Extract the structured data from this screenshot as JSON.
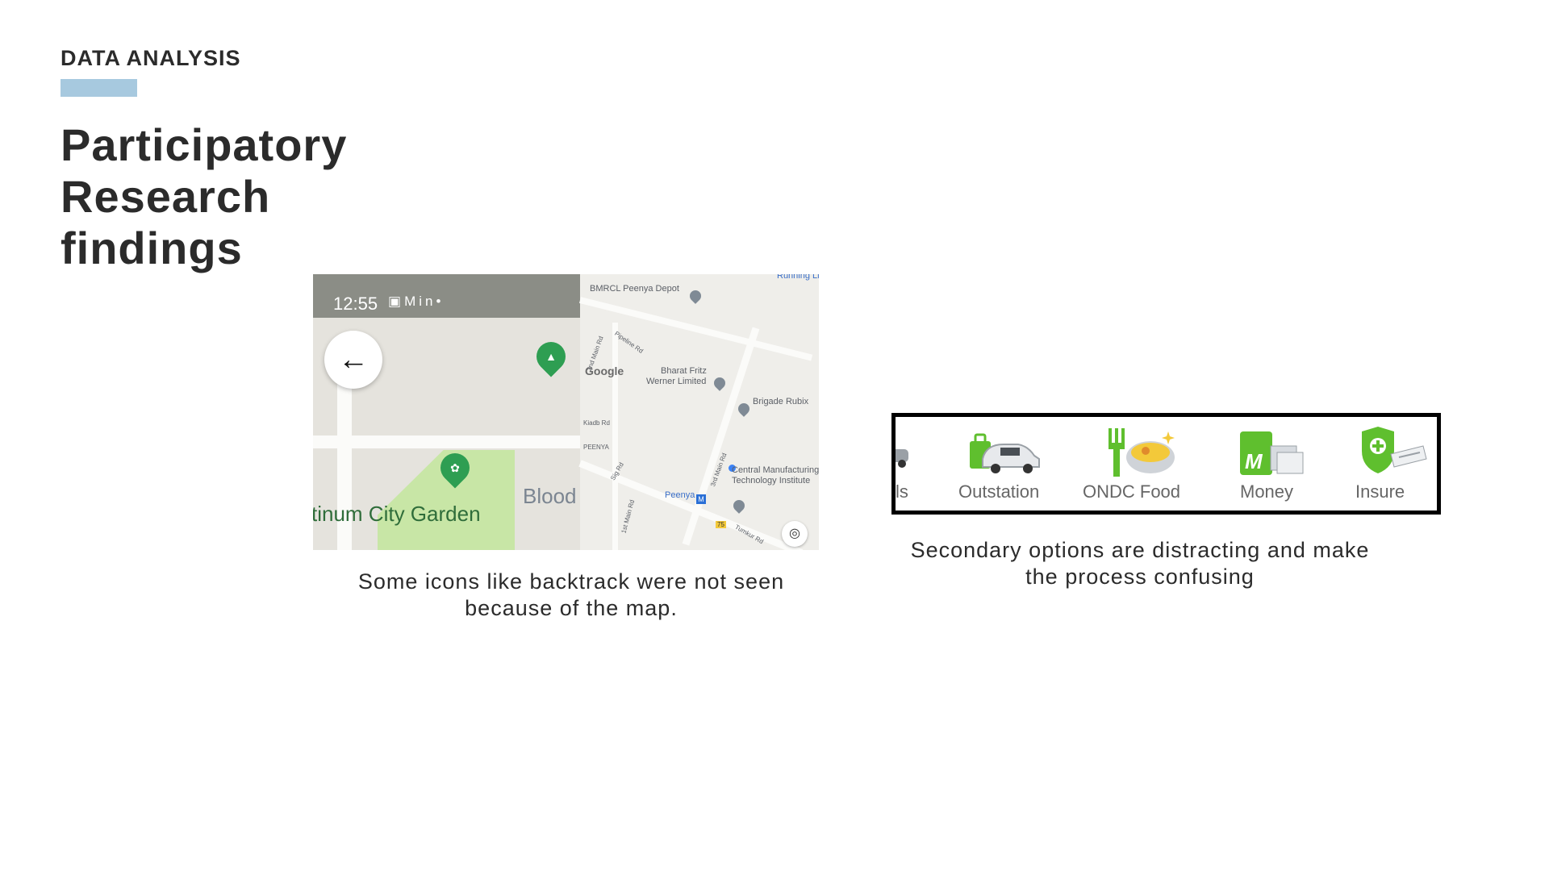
{
  "header": {
    "eyebrow": "DATA ANALYSIS",
    "title": "Participatory\nResearch\nfindings"
  },
  "colors": {
    "accent_bar": "#a7c9df",
    "heading_text": "#2b2b2b",
    "icon_green": "#5fbf2e"
  },
  "map_screenshot": {
    "status_time": "12:55",
    "status_icons": [
      "image-icon",
      "gmail-icon",
      "linkedin-icon",
      "dot-icon"
    ],
    "back_icon": "arrow-left-icon",
    "park_label": "tinum City Garden",
    "area_label": "Blood",
    "google_logo": "Google",
    "pois": {
      "depot": "BMRCL Peenya Depot",
      "running": "Running Lin",
      "bharat1": "Bharat Fritz",
      "bharat2": "Werner Limited",
      "brigade": "Brigade Rubix",
      "central1": "Central Manufacturing",
      "central2": "Technology Institute",
      "peenya_station": "Peenya",
      "peenya_area": "PEENYA",
      "kiadb": "Kiadb Rd",
      "pipeline": "Pipeline Rd",
      "main2": "2nd Main Rd",
      "main3": "3rd Main Rd",
      "main1": "1st Main Rd",
      "sig": "Sig Rd",
      "tumkur": "Tumkur Rd",
      "route": "75",
      "metro": "M"
    }
  },
  "captions": {
    "left": "Some icons like backtrack were not seen because of the map.",
    "right": "Secondary options are distracting and make the process confusing"
  },
  "icon_strip": {
    "items": [
      {
        "label": "ls",
        "icon": "car-icon"
      },
      {
        "label": "Outstation",
        "icon": "outstation-car-icon"
      },
      {
        "label": "ONDC Food",
        "icon": "food-bowl-icon"
      },
      {
        "label": "Money",
        "icon": "money-icon"
      },
      {
        "label": "Insure",
        "icon": "insurance-shield-icon"
      }
    ]
  }
}
